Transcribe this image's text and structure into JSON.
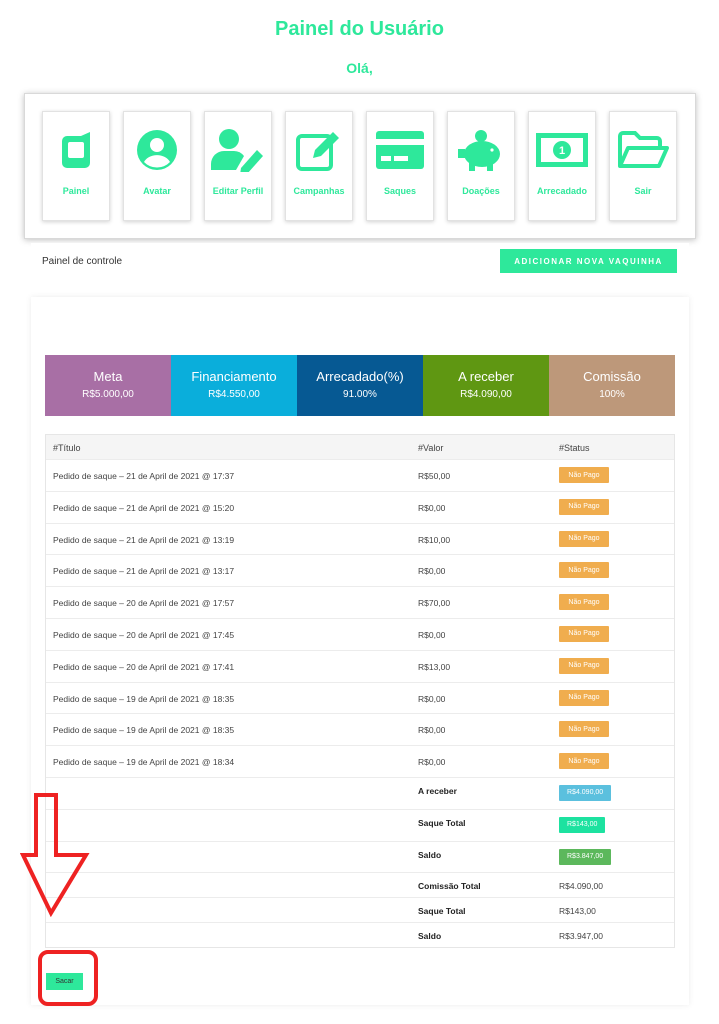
{
  "header": {
    "title": "Painel do Usuário",
    "greeting": "Olá,"
  },
  "menu": [
    {
      "label": "Painel",
      "icon": "tablet-icon"
    },
    {
      "label": "Avatar",
      "icon": "user-circle-icon"
    },
    {
      "label": "Editar Perfil",
      "icon": "user-edit-icon"
    },
    {
      "label": "Campanhas",
      "icon": "edit-icon"
    },
    {
      "label": "Saques",
      "icon": "credit-card-icon"
    },
    {
      "label": "Doações",
      "icon": "piggy-bank-icon"
    },
    {
      "label": "Arrecadado",
      "icon": "money-bill-icon"
    },
    {
      "label": "Sair",
      "icon": "folder-open-icon"
    }
  ],
  "control": {
    "label": "Painel de controle",
    "add_button": "ADICIONAR NOVA VAQUINHA"
  },
  "stats": [
    {
      "title": "Meta",
      "value": "R$5.000,00",
      "color": "#a86fa5"
    },
    {
      "title": "Financiamento",
      "value": "R$4.550,00",
      "color": "#0aaedb"
    },
    {
      "title": "Arrecadado(%)",
      "value": "91.00%",
      "color": "#065993"
    },
    {
      "title": "A receber",
      "value": "R$4.090,00",
      "color": "#5f9712"
    },
    {
      "title": "Comissão",
      "value": "100%",
      "color": "#bd987a"
    }
  ],
  "table": {
    "headers": [
      "#Título",
      "#Valor",
      "#Status"
    ],
    "rows": [
      {
        "title": "Pedido de saque – 21 de April de 2021 @ 17:37",
        "value": "R$50,00",
        "status": "Não Pago"
      },
      {
        "title": "Pedido de saque – 21 de April de 2021 @ 15:20",
        "value": "R$0,00",
        "status": "Não Pago"
      },
      {
        "title": "Pedido de saque – 21 de April de 2021 @ 13:19",
        "value": "R$10,00",
        "status": "Não Pago"
      },
      {
        "title": "Pedido de saque – 21 de April de 2021 @ 13:17",
        "value": "R$0,00",
        "status": "Não Pago"
      },
      {
        "title": "Pedido de saque – 20 de April de 2021 @ 17:57",
        "value": "R$70,00",
        "status": "Não Pago"
      },
      {
        "title": "Pedido de saque – 20 de April de 2021 @ 17:45",
        "value": "R$0,00",
        "status": "Não Pago"
      },
      {
        "title": "Pedido de saque – 20 de April de 2021 @ 17:41",
        "value": "R$13,00",
        "status": "Não Pago"
      },
      {
        "title": "Pedido de saque – 19 de April de 2021 @ 18:35",
        "value": "R$0,00",
        "status": "Não Pago"
      },
      {
        "title": "Pedido de saque – 19 de April de 2021 @ 18:35",
        "value": "R$0,00",
        "status": "Não Pago"
      },
      {
        "title": "Pedido de saque – 19 de April de 2021 @ 18:34",
        "value": "R$0,00",
        "status": "Não Pago"
      }
    ],
    "summary_badges": [
      {
        "label": "A receber",
        "value": "R$4.090,00"
      },
      {
        "label": "Saque Total",
        "value": "R$143,00"
      },
      {
        "label": "Saldo",
        "value": "R$3.847,00"
      }
    ],
    "summary_text": [
      {
        "label": "Comissão Total",
        "value": "R$4.090,00"
      },
      {
        "label": "Saque Total",
        "value": "R$143,00"
      },
      {
        "label": "Saldo",
        "value": "R$3.947,00"
      }
    ]
  },
  "withdraw_button": "Sacar",
  "colors": {
    "accent": "#2ee89b",
    "annotation": "#ee2222"
  }
}
